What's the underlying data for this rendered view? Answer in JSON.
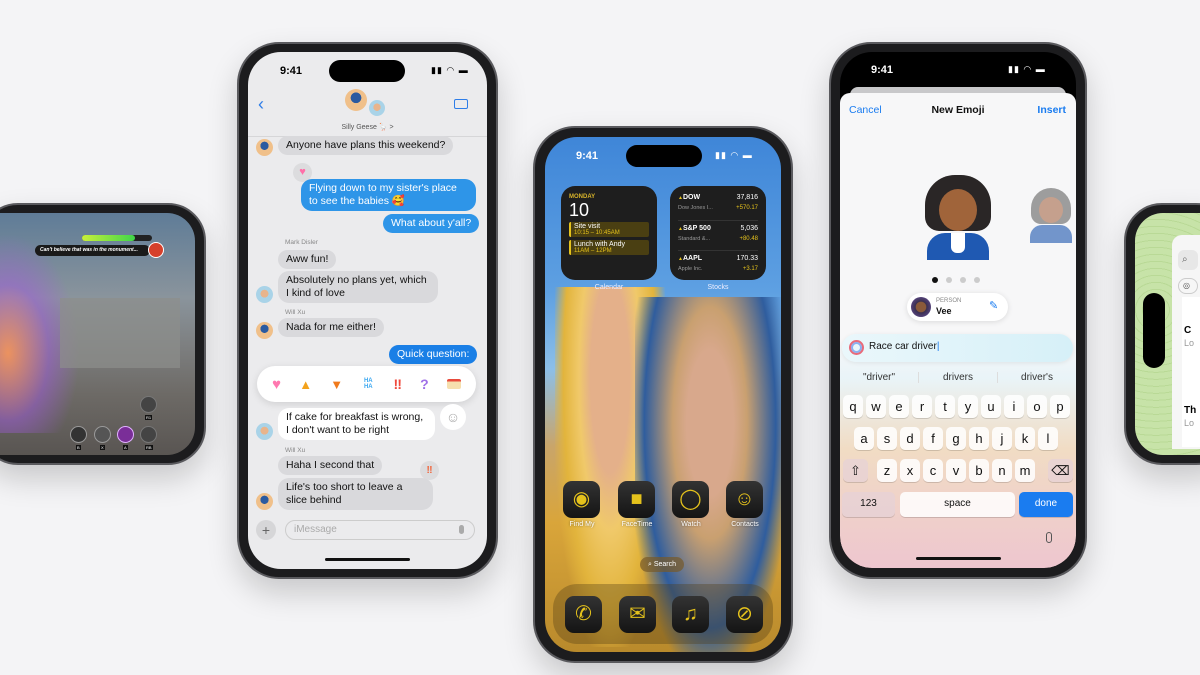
{
  "game_phone": {
    "dialog_text": "Can't believe that was in the monument...",
    "button_hints": [
      "B",
      "X",
      "A",
      "R1",
      "RB"
    ]
  },
  "messages_phone": {
    "time": "9:41",
    "group_name": "Silly Geese 🪿 >",
    "messages": [
      {
        "sender": "",
        "text": "Anyone have plans this weekend?",
        "type": "received"
      },
      {
        "sender": "",
        "text": "Flying down to my sister's place to see the babies 🥰",
        "type": "sent",
        "tapback": "heart"
      },
      {
        "sender": "",
        "text": "What about y'all?",
        "type": "sent"
      },
      {
        "sender": "Mark Disler",
        "text": "Aww fun!",
        "type": "received"
      },
      {
        "sender": "",
        "text": "Absolutely no plans yet, which I kind of love",
        "type": "received"
      },
      {
        "sender": "Will Xu",
        "text": "Nada for me either!",
        "type": "received"
      },
      {
        "sender": "",
        "text": "Quick question:",
        "type": "sent"
      },
      {
        "sender": "",
        "text": "If cake for breakfast is wrong, I don't want to be right",
        "type": "received",
        "selected": true
      },
      {
        "sender": "Will Xu",
        "text": "Haha I second that",
        "type": "received"
      },
      {
        "sender": "",
        "text": "Life's too short to leave a slice behind",
        "type": "received",
        "tapback": "exclamation"
      }
    ],
    "tapbacks": [
      "♥",
      "👍",
      "👎",
      "HA HA",
      "‼",
      "?",
      "cake"
    ],
    "input_placeholder": "iMessage",
    "accent": "#2e95e8"
  },
  "home_phone": {
    "time": "9:41",
    "calendar": {
      "day": "MONDAY",
      "date": "10",
      "events": [
        {
          "title": "Site visit",
          "time": "10:15 – 10:45AM"
        },
        {
          "title": "Lunch with Andy",
          "time": "11AM – 12PM"
        }
      ],
      "label": "Calendar"
    },
    "stocks": {
      "items": [
        {
          "symbol": "DOW",
          "name": "Dow Jones I...",
          "price": "37,816",
          "change": "+570.17"
        },
        {
          "symbol": "S&P 500",
          "name": "Standard &...",
          "price": "5,036",
          "change": "+80.48"
        },
        {
          "symbol": "AAPL",
          "name": "Apple Inc.",
          "price": "170.33",
          "change": "+3.17"
        }
      ],
      "label": "Stocks"
    },
    "apps": [
      "Find My",
      "FaceTime",
      "Watch",
      "Contacts"
    ],
    "search_label": "Search",
    "dock": [
      "phone-icon",
      "mail-icon",
      "music-icon",
      "compass-icon"
    ],
    "tint": "#e5c21c"
  },
  "emoji_phone": {
    "time": "9:41",
    "cancel": "Cancel",
    "title": "New Emoji",
    "insert": "Insert",
    "person_label": "PERSON",
    "person_name": "Vee",
    "prompt": "Race car driver",
    "suggestions": [
      "\"driver\"",
      "drivers",
      "driver's"
    ],
    "keys_row1": [
      "q",
      "w",
      "e",
      "r",
      "t",
      "y",
      "u",
      "i",
      "o",
      "p"
    ],
    "keys_row2": [
      "a",
      "s",
      "d",
      "f",
      "g",
      "h",
      "j",
      "k",
      "l"
    ],
    "keys_row3": [
      "z",
      "x",
      "c",
      "v",
      "b",
      "n",
      "m"
    ],
    "key_123": "123",
    "key_space": "space",
    "key_done": "done",
    "accent": "#1a7cf0"
  },
  "maps_phone": {
    "fragments": [
      "C",
      "Lo",
      "Th",
      "Lo"
    ]
  }
}
